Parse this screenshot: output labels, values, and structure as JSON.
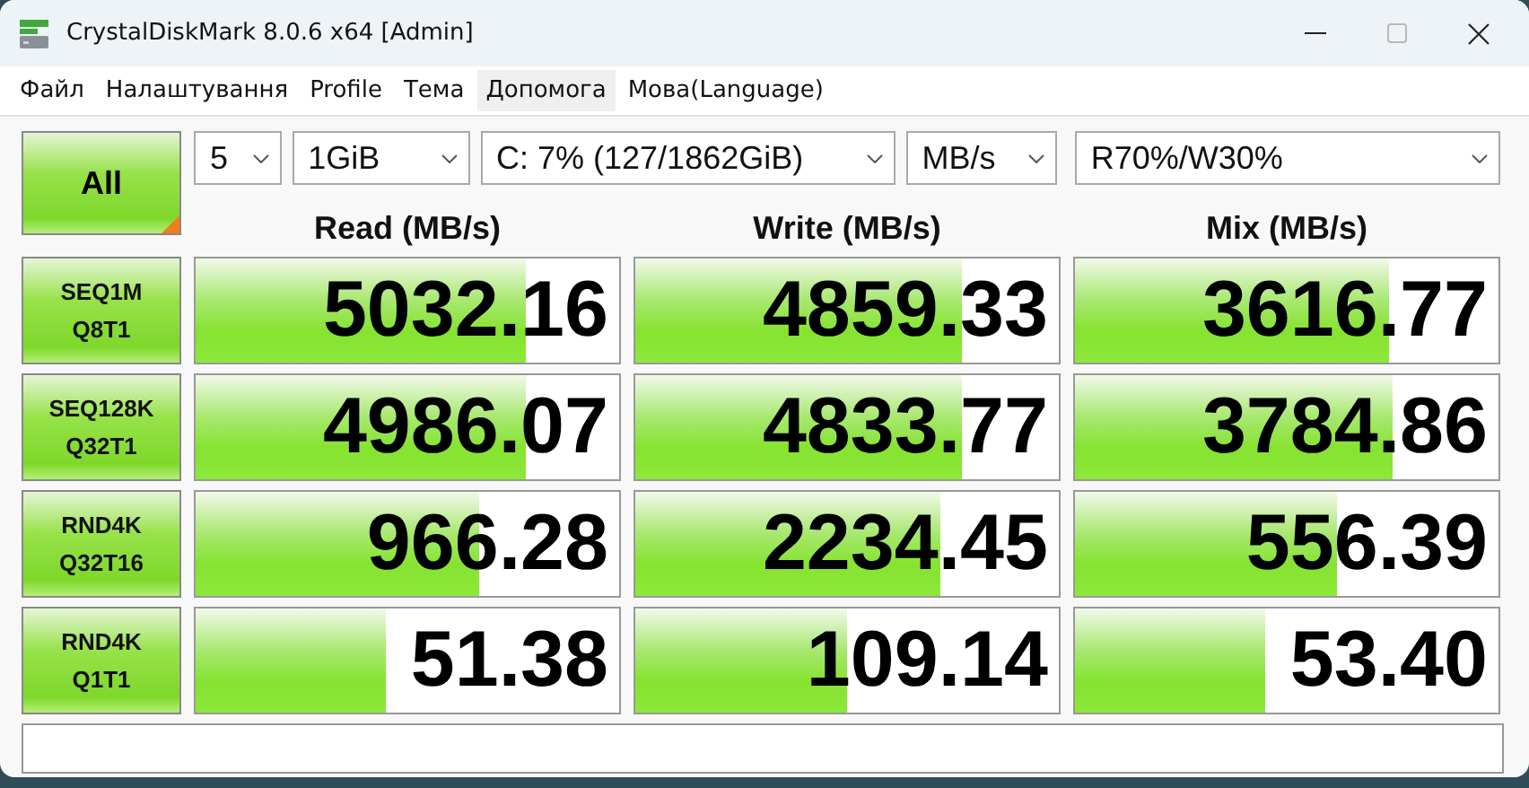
{
  "window": {
    "title": "CrystalDiskMark 8.0.6 x64 [Admin]"
  },
  "menu": [
    {
      "label": "Файл",
      "highlighted": false
    },
    {
      "label": "Налаштування",
      "highlighted": false
    },
    {
      "label": "Profile",
      "highlighted": false
    },
    {
      "label": "Тема",
      "highlighted": false
    },
    {
      "label": "Допомога",
      "highlighted": true
    },
    {
      "label": "Мова(Language)",
      "highlighted": false
    }
  ],
  "all_button": {
    "label": "All"
  },
  "dropdowns": [
    {
      "value": "5"
    },
    {
      "value": "1GiB"
    },
    {
      "value": "C: 7% (127/1862GiB)"
    },
    {
      "value": "MB/s"
    },
    {
      "value": "R70%/W30%"
    }
  ],
  "columns": [
    "Read (MB/s)",
    "Write (MB/s)",
    "Mix (MB/s)"
  ],
  "tests": [
    {
      "name": "SEQ1M",
      "params": "Q8T1",
      "results": [
        {
          "value": "5032.16",
          "level": 0.78
        },
        {
          "value": "4859.33",
          "level": 0.77
        },
        {
          "value": "3616.77",
          "level": 0.74
        }
      ]
    },
    {
      "name": "SEQ128K",
      "params": "Q32T1",
      "results": [
        {
          "value": "4986.07",
          "level": 0.78
        },
        {
          "value": "4833.77",
          "level": 0.77
        },
        {
          "value": "3784.86",
          "level": 0.75
        }
      ]
    },
    {
      "name": "RND4K",
      "params": "Q32T16",
      "results": [
        {
          "value": "966.28",
          "level": 0.67
        },
        {
          "value": "2234.45",
          "level": 0.72
        },
        {
          "value": "556.39",
          "level": 0.62
        }
      ]
    },
    {
      "name": "RND4K",
      "params": "Q1T1",
      "results": [
        {
          "value": "51.38",
          "level": 0.45
        },
        {
          "value": "109.14",
          "level": 0.5
        },
        {
          "value": "53.40",
          "level": 0.45
        }
      ]
    }
  ]
}
